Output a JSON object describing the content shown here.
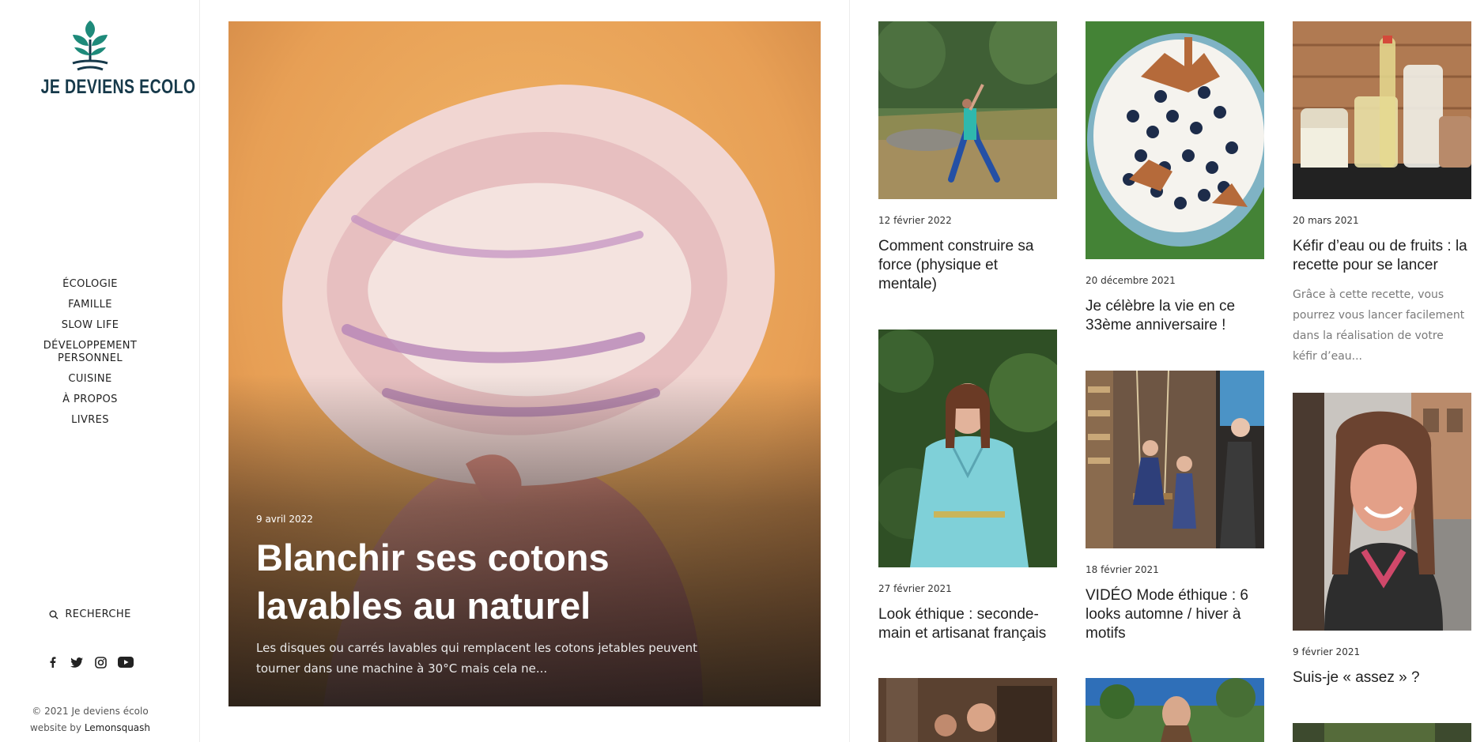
{
  "site": {
    "logo_text": "JE DEVIENS ECOLO",
    "brand_colors": {
      "logo_navy": "#16394a",
      "logo_teal": "#1e8a7a"
    }
  },
  "nav": {
    "items": [
      {
        "label": "ÉCOLOGIE"
      },
      {
        "label": "FAMILLE"
      },
      {
        "label": "SLOW LIFE"
      },
      {
        "label": "DÉVELOPPEMENT PERSONNEL"
      },
      {
        "label": "CUISINE"
      },
      {
        "label": "À PROPOS"
      },
      {
        "label": "LIVRES"
      }
    ]
  },
  "search": {
    "label": "RECHERCHE",
    "icon": "search-icon"
  },
  "socials": [
    "facebook-icon",
    "twitter-icon",
    "instagram-icon",
    "youtube-icon"
  ],
  "footer": {
    "copyright": "© 2021 Je deviens écolo",
    "credit_prefix": "website by",
    "credit_name": "Lemonsquash"
  },
  "featured": {
    "date": "9 avril 2022",
    "title": "Blanchir ses cotons lavables au naturel",
    "excerpt": "Les disques ou carrés lavables qui remplacent les cotons jetables peuvent tourner dans une machine à 30°C mais cela ne..."
  },
  "posts": {
    "col1": [
      {
        "date": "12 février 2022",
        "title": "Comment construire sa force (physique et mentale)"
      },
      {
        "date": "27 février 2021",
        "title": "Look éthique : seconde-main et artisanat français"
      }
    ],
    "col2": [
      {
        "date": "20 décembre 2021",
        "title": "Je célèbre la vie en ce 33ème anniversaire !"
      },
      {
        "date": "18 février 2021",
        "title": "VIDÉO Mode éthique : 6 looks automne / hiver à motifs"
      }
    ],
    "col3": [
      {
        "date": "20 mars 2021",
        "title": "Kéfir d’eau ou de fruits : la recette pour se lancer",
        "excerpt": "Grâce à cette recette, vous pourrez vous lancer facilement dans la réalisation de votre kéfir d’eau..."
      },
      {
        "date": "9 février 2021",
        "title": "Suis-je « assez » ?"
      }
    ]
  }
}
